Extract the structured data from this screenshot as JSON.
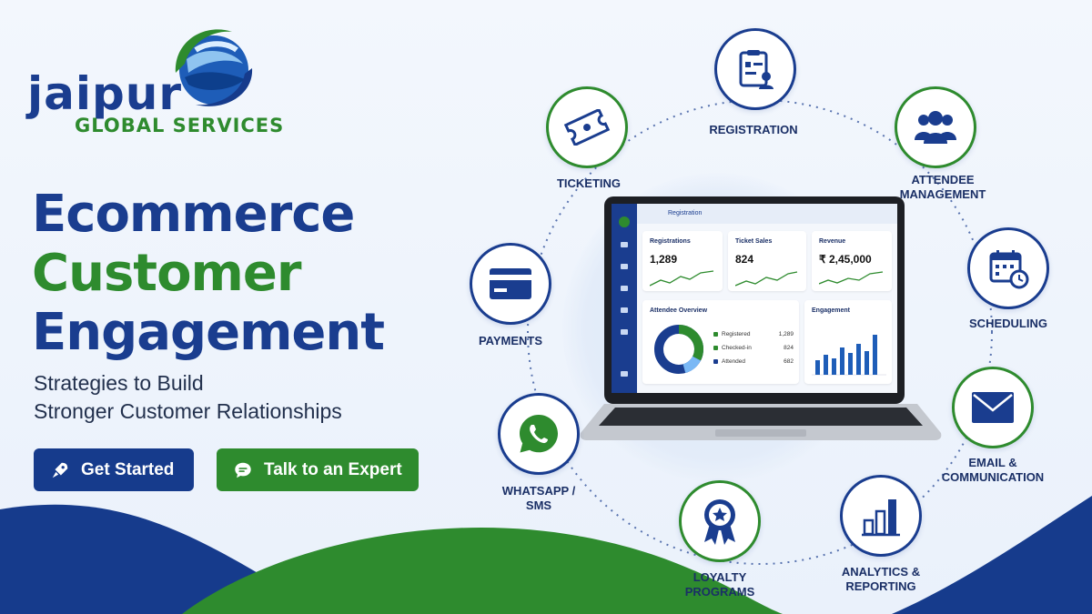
{
  "brand": {
    "name_top": "jaipur",
    "name_bottom": "GLOBAL SERVICES",
    "colors": {
      "blue": "#1a3d8f",
      "green": "#2e8b2e"
    }
  },
  "hero": {
    "title_line1": "Ecommerce",
    "title_line2": "Customer",
    "title_line3": "Engagement",
    "subtitle_line1": "Strategies to Build",
    "subtitle_line2": "Stronger Customer Relationships"
  },
  "buttons": {
    "primary": {
      "label": "Get Started",
      "icon": "rocket-icon"
    },
    "secondary": {
      "label": "Talk to an Expert",
      "icon": "chat-icon"
    }
  },
  "features": [
    {
      "label": "REGISTRATION",
      "icon": "clipboard-user-icon"
    },
    {
      "label": "ATTENDEE\nMANAGEMENT",
      "icon": "group-icon"
    },
    {
      "label": "SCHEDULING",
      "icon": "calendar-clock-icon"
    },
    {
      "label": "EMAIL &\nCOMMUNICATION",
      "icon": "envelope-icon"
    },
    {
      "label": "ANALYTICS &\nREPORTING",
      "icon": "bar-chart-icon"
    },
    {
      "label": "LOYALTY\nPROGRAMS",
      "icon": "award-icon"
    },
    {
      "label": "WHATSAPP /\nSMS",
      "icon": "whatsapp-icon"
    },
    {
      "label": "PAYMENTS",
      "icon": "credit-card-icon"
    },
    {
      "label": "TICKETING",
      "icon": "ticket-icon"
    }
  ],
  "dashboard": {
    "header": "Registration",
    "stats": [
      {
        "title": "Registrations",
        "value": "1,289"
      },
      {
        "title": "Ticket Sales",
        "value": "824"
      },
      {
        "title": "Revenue",
        "value": "₹ 2,45,000"
      }
    ],
    "overview": {
      "title": "Attendee Overview",
      "legend": [
        {
          "label": "Registered",
          "value": "1,289",
          "color": "#2e8b2e"
        },
        {
          "label": "Checked-in",
          "value": "824",
          "color": "#2e8b2e"
        },
        {
          "label": "Attended",
          "value": "682",
          "color": "#1a3d8f"
        }
      ]
    },
    "engagement": {
      "title": "Engagement"
    }
  }
}
